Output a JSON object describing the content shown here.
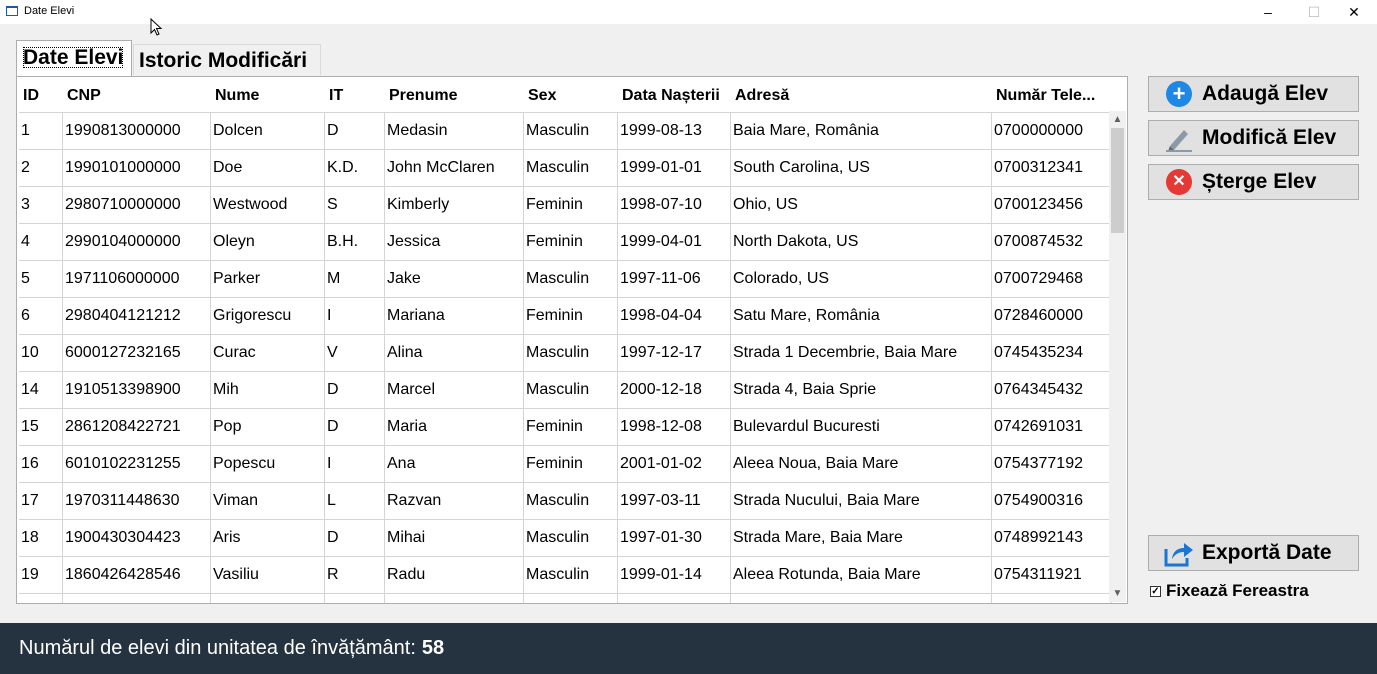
{
  "window": {
    "title": "Date Elevi",
    "minimize": "–",
    "maximize": "☐",
    "close": "✕"
  },
  "tabs": [
    {
      "label": "Date Elevi",
      "active": true
    },
    {
      "label": "Istoric Modificări",
      "active": false
    }
  ],
  "table": {
    "headers": [
      "ID",
      "CNP",
      "Nume",
      "IT",
      "Prenume",
      "Sex",
      "Data Nașterii",
      "Adresă",
      "Număr Tele..."
    ],
    "rows": [
      [
        "1",
        "1990813000000",
        "Dolcen",
        "D",
        "Medasin",
        "Masculin",
        "1999-08-13",
        "Baia Mare, România",
        "0700000000"
      ],
      [
        "2",
        "1990101000000",
        "Doe",
        "K.D.",
        "John McClaren",
        "Masculin",
        "1999-01-01",
        "South Carolina, US",
        "0700312341"
      ],
      [
        "3",
        "2980710000000",
        "Westwood",
        "S",
        "Kimberly",
        "Feminin",
        "1998-07-10",
        "Ohio, US",
        "0700123456"
      ],
      [
        "4",
        "2990104000000",
        "Oleyn",
        "B.H.",
        "Jessica",
        "Feminin",
        "1999-04-01",
        "North Dakota, US",
        "0700874532"
      ],
      [
        "5",
        "1971106000000",
        "Parker",
        "M",
        "Jake",
        "Masculin",
        "1997-11-06",
        "Colorado, US",
        "0700729468"
      ],
      [
        "6",
        "2980404121212",
        "Grigorescu",
        "I",
        "Mariana",
        "Feminin",
        "1998-04-04",
        "Satu Mare, România",
        "0728460000"
      ],
      [
        "10",
        "6000127232165",
        "Curac",
        "V",
        "Alina",
        "Masculin",
        "1997-12-17",
        "Strada 1 Decembrie, Baia Mare",
        "0745435234"
      ],
      [
        "14",
        "1910513398900",
        "Mih",
        "D",
        "Marcel",
        "Masculin",
        "2000-12-18",
        "Strada 4, Baia Sprie",
        "0764345432"
      ],
      [
        "15",
        "2861208422721",
        "Pop",
        "D",
        "Maria",
        "Feminin",
        "1998-12-08",
        "Bulevardul Bucuresti",
        "0742691031"
      ],
      [
        "16",
        "6010102231255",
        "Popescu",
        "I",
        "Ana",
        "Feminin",
        "2001-01-02",
        "Aleea Noua, Baia Mare",
        "0754377192"
      ],
      [
        "17",
        "1970311448630",
        "Viman",
        "L",
        "Razvan",
        "Masculin",
        "1997-03-11",
        "Strada Nucului, Baia Mare",
        "0754900316"
      ],
      [
        "18",
        "1900430304423",
        "Aris",
        "D",
        "Mihai",
        "Masculin",
        "1997-01-30",
        "Strada Mare, Baia Mare",
        "0748992143"
      ],
      [
        "19",
        "1860426428546",
        "Vasiliu",
        "R",
        "Radu",
        "Masculin",
        "1999-01-14",
        "Aleea Rotunda, Baia Mare",
        "0754311921"
      ]
    ]
  },
  "actions": {
    "add": "Adaugă Elev",
    "edit": "Modifică Elev",
    "delete": "Șterge Elev",
    "export": "Exportă Date"
  },
  "pin_window": {
    "label": "Fixează Fereastra",
    "checked": true
  },
  "footer": {
    "label": "Numărul de elevi din unitatea de învățământ:",
    "count": "58"
  },
  "colors": {
    "add": "#1e88e5",
    "delete": "#e53935",
    "footer_bg": "#25323f",
    "edit": "#7a8a99",
    "export": "#1976d2"
  }
}
